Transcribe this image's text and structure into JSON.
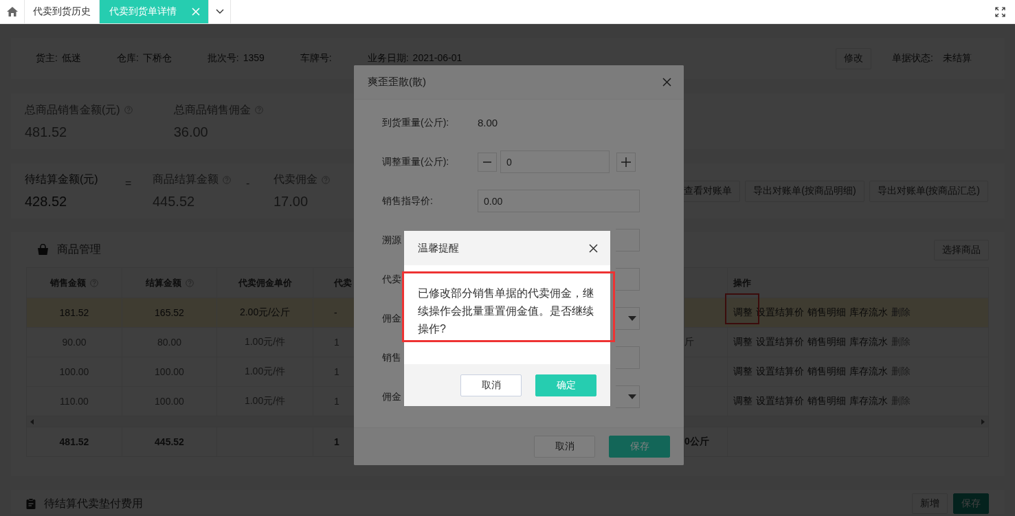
{
  "tabs": [
    {
      "kind": "home",
      "selected": false
    },
    {
      "kind": "page",
      "label": "代卖到货历史",
      "selected": false
    },
    {
      "kind": "page",
      "label": "代卖到货单详情",
      "selected": true,
      "closable": true
    }
  ],
  "info": {
    "fields": [
      {
        "label": "货主:",
        "value": "低迷"
      },
      {
        "label": "仓库:",
        "value": "下桥仓"
      },
      {
        "label": "批次号:",
        "value": "1359"
      },
      {
        "label": "车牌号:"
      },
      {
        "label": "业务日期:",
        "value": "2021-06-01"
      }
    ],
    "edit_button": "修改",
    "status_label": "单据状态:",
    "status_value": "未结算"
  },
  "totals": [
    {
      "label": "总商品销售金额(元)",
      "help": true,
      "value": "481.52"
    },
    {
      "label": "总商品销售佣金",
      "help": true,
      "value": "36.00"
    }
  ],
  "settlement": {
    "items": [
      {
        "kind": "total",
        "label": "待结算金额(元)",
        "value": "428.52"
      },
      {
        "kind": "op",
        "label": "="
      },
      {
        "kind": "stat",
        "label": "商品结算金额",
        "help": true,
        "value": "445.52"
      },
      {
        "kind": "op",
        "label": "-"
      },
      {
        "kind": "stat",
        "label": "代卖佣金",
        "help": true,
        "value": "17.00"
      }
    ],
    "buttons": [
      "查看对账单",
      "导出对账单(按商品明细)",
      "导出对账单(按商品汇总)"
    ]
  },
  "goods": {
    "title": "商品管理",
    "select_button": "选择商品",
    "columns": {
      "sales": {
        "label": "销售金额",
        "help": true
      },
      "settle": {
        "label": "结算金额",
        "help": true
      },
      "unit": {
        "label": "代卖佣金单价"
      },
      "column_4": {
        "label": "代卖"
      },
      "actions": {
        "label": "操作"
      }
    },
    "rows": [
      {
        "selected": true,
        "sales": "181.52",
        "settle": "165.52",
        "unit": "2.00元/公斤",
        "column_4": "-",
        "actions": [
          {
            "label": "调整",
            "disabled": false,
            "highlighted": true
          },
          {
            "label": "设置结算价",
            "disabled": false
          },
          {
            "label": "销售明细",
            "disabled": false
          },
          {
            "label": "库存流水",
            "disabled": false
          },
          {
            "label": "删除",
            "disabled": true
          }
        ]
      },
      {
        "selected": false,
        "sales": "90.00",
        "settle": "80.00",
        "unit": "1.00元/件",
        "column_4": "1",
        "column_6": "斤",
        "actions": [
          {
            "label": "调整",
            "disabled": false
          },
          {
            "label": "设置结算价",
            "disabled": false
          },
          {
            "label": "销售明细",
            "disabled": false
          },
          {
            "label": "库存流水",
            "disabled": false
          },
          {
            "label": "删除",
            "disabled": true
          }
        ]
      },
      {
        "selected": false,
        "sales": "100.00",
        "settle": "100.00",
        "unit": "1.00元/件",
        "column_4": "1",
        "actions": [
          {
            "label": "调整",
            "disabled": false
          },
          {
            "label": "设置结算价",
            "disabled": false
          },
          {
            "label": "销售明细",
            "disabled": false
          },
          {
            "label": "库存流水",
            "disabled": false
          },
          {
            "label": "删除",
            "disabled": true
          }
        ]
      },
      {
        "selected": false,
        "sales": "110.00",
        "settle": "100.00",
        "unit": "1.00元/件",
        "column_4": "1",
        "actions": [
          {
            "label": "调整",
            "disabled": false
          },
          {
            "label": "设置结算价",
            "disabled": false
          },
          {
            "label": "销售明细",
            "disabled": false
          },
          {
            "label": "库存流水",
            "disabled": false
          },
          {
            "label": "删除",
            "disabled": true
          }
        ]
      }
    ],
    "footer": {
      "sales": "481.52",
      "settle": "445.52",
      "column_4": "1",
      "column_6": "0公斤"
    }
  },
  "fees": {
    "title": "待结算代卖垫付费用",
    "buttons": [
      {
        "label": "新增",
        "kind": "plain"
      },
      {
        "label": "保存",
        "kind": "primary"
      }
    ]
  },
  "edit_dialog": {
    "title": "爽歪歪散(散)",
    "rows": [
      {
        "kind": "text",
        "label": "到货重量(公斤):",
        "value": "8.00"
      },
      {
        "kind": "stepper",
        "label": "调整重量(公斤):",
        "value": "0"
      },
      {
        "kind": "input",
        "label": "销售指导价:",
        "value": "0.00"
      },
      {
        "kind": "input",
        "label": "溯源"
      },
      {
        "kind": "input",
        "label": "代卖"
      },
      {
        "kind": "select",
        "label": "佣金"
      },
      {
        "kind": "input",
        "label": "销售"
      },
      {
        "kind": "select",
        "label": "佣金"
      }
    ],
    "cancel": "取消",
    "save": "保存"
  },
  "confirm_dialog": {
    "title": "温馨提醒",
    "message": "已修改部分销售单据的代卖佣金，继续操作会批量重置佣金值。是否继续操作?",
    "message_highlighted": true,
    "cancel": "取消",
    "ok": "确定"
  }
}
